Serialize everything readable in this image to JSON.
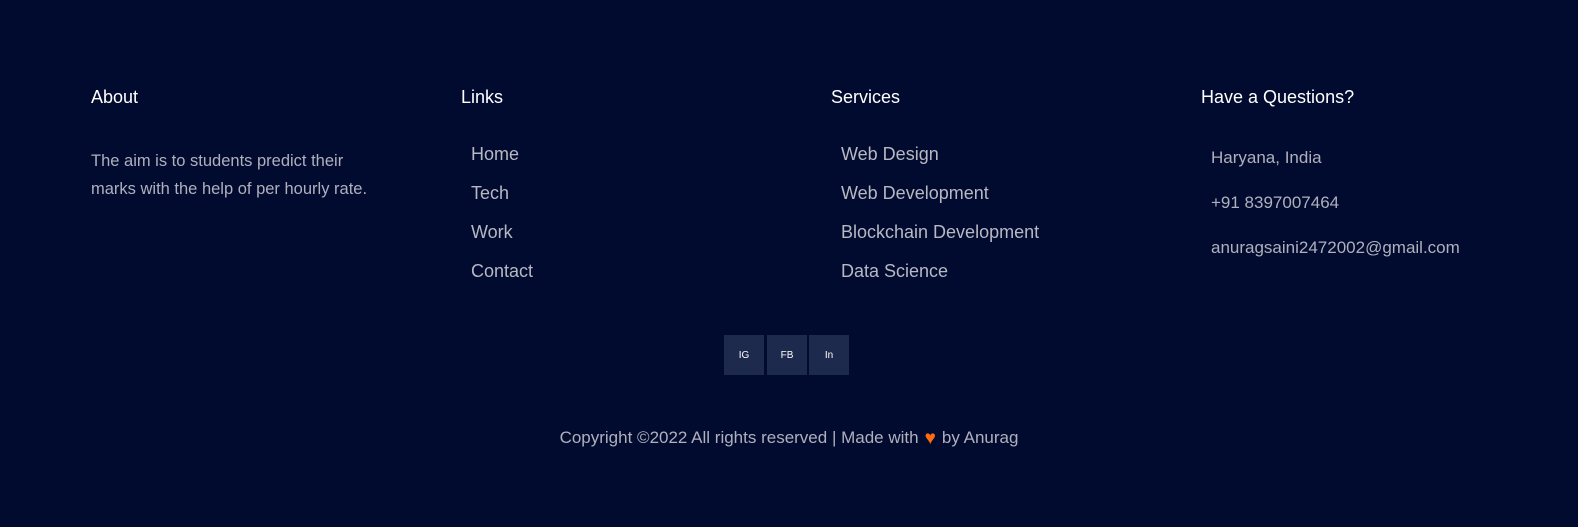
{
  "about": {
    "heading": "About",
    "text": "The aim is to students predict their marks with the help of per hourly rate."
  },
  "links": {
    "heading": "Links",
    "items": [
      "Home",
      "Tech",
      "Work",
      "Contact"
    ]
  },
  "services": {
    "heading": "Services",
    "items": [
      "Web Design",
      "Web Development",
      "Blockchain Development",
      "Data Science"
    ]
  },
  "contact": {
    "heading": "Have a Questions?",
    "location": "Haryana, India",
    "phone": "+91 8397007464",
    "email": "anuragsaini2472002@gmail.com"
  },
  "social": {
    "instagram": "IG",
    "facebook": "FB",
    "linkedin": "In"
  },
  "footer": {
    "copyright_prefix": "Copyright ©2022 All rights reserved | Made with",
    "heart_icon": "heart-icon",
    "copyright_suffix": "by Anurag"
  },
  "colors": {
    "background": "#000b2f",
    "social_bg": "#1e2a4d",
    "heart": "#ff6a13"
  }
}
